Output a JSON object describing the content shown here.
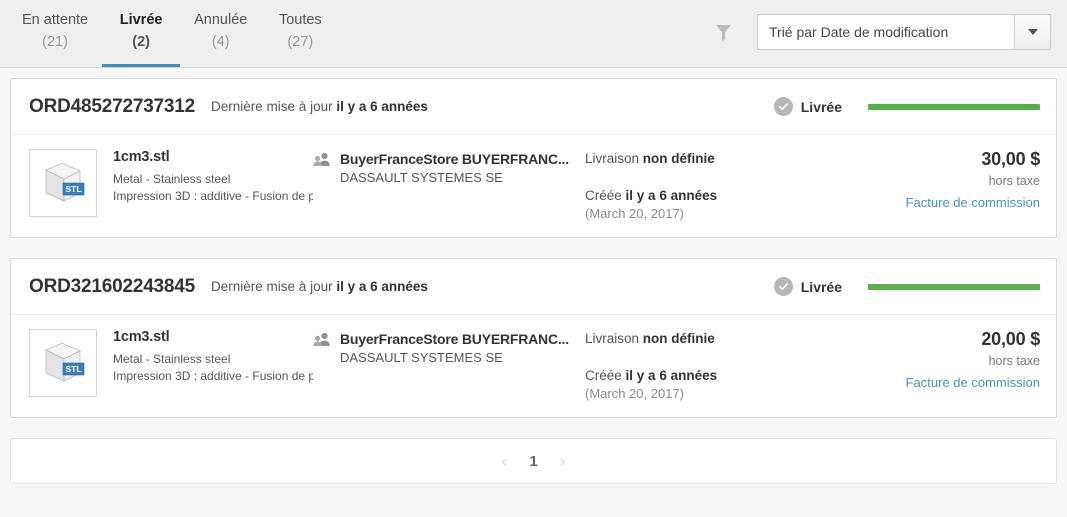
{
  "header": {
    "tabs": [
      {
        "label": "En attente",
        "count": "(21)",
        "active": false
      },
      {
        "label": "Livrée",
        "count": "(2)",
        "active": true
      },
      {
        "label": "Annulée",
        "count": "(4)",
        "active": false
      },
      {
        "label": "Toutes",
        "count": "(27)",
        "active": false
      }
    ],
    "filter_icon": "funnel-icon",
    "sort": {
      "value": "Trié par Date de modification",
      "placeholder": "Trié par Date de modification",
      "arrow_icon": "chevron-down-icon"
    }
  },
  "colors": {
    "accent_blue": "#3b8dc4",
    "progress_green": "#56b04a",
    "link_blue": "#4a90b8",
    "status_grey": "#b5b8ba",
    "page_bg": "#f7f7f7",
    "header_bg": "#efefef"
  },
  "orders": [
    {
      "id": "ORD485272737312",
      "updated_prefix": "Dernière mise à jour",
      "updated_value": "il y a 6 années",
      "status": {
        "icon": "check-circle-icon",
        "label": "Livrée",
        "progress_percent": 100
      },
      "product": {
        "thumbnail_icon": "stl-cube-thumbnail",
        "thumbnail_badge": "STL",
        "name": "1cm3.stl",
        "material": "Metal - Stainless steel",
        "process": "Impression 3D : additive - Fusion de p..."
      },
      "buyer": {
        "icon": "people-icon",
        "name": "BuyerFranceStore BUYERFRANC...",
        "company": "DASSAULT SYSTEMES SE"
      },
      "delivery": {
        "label": "Livraison",
        "value": "non définie"
      },
      "created": {
        "label": "Créée",
        "value": "il y a 6 années",
        "date": "(March 20, 2017)"
      },
      "price": {
        "amount": "30,00 $",
        "tax_note": "hors taxe",
        "invoice_link": "Facture de commission"
      }
    },
    {
      "id": "ORD321602243845",
      "updated_prefix": "Dernière mise à jour",
      "updated_value": "il y a 6 années",
      "status": {
        "icon": "check-circle-icon",
        "label": "Livrée",
        "progress_percent": 100
      },
      "product": {
        "thumbnail_icon": "stl-cube-thumbnail",
        "thumbnail_badge": "STL",
        "name": "1cm3.stl",
        "material": "Metal - Stainless steel",
        "process": "Impression 3D : additive - Fusion de p..."
      },
      "buyer": {
        "icon": "people-icon",
        "name": "BuyerFranceStore BUYERFRANC...",
        "company": "DASSAULT SYSTEMES SE"
      },
      "delivery": {
        "label": "Livraison",
        "value": "non définie"
      },
      "created": {
        "label": "Créée",
        "value": "il y a 6 années",
        "date": "(March 20, 2017)"
      },
      "price": {
        "amount": "20,00 $",
        "tax_note": "hors taxe",
        "invoice_link": "Facture de commission"
      }
    }
  ],
  "pagination": {
    "prev_icon": "chevron-left-icon",
    "next_icon": "chevron-right-icon",
    "current_page": "1"
  }
}
